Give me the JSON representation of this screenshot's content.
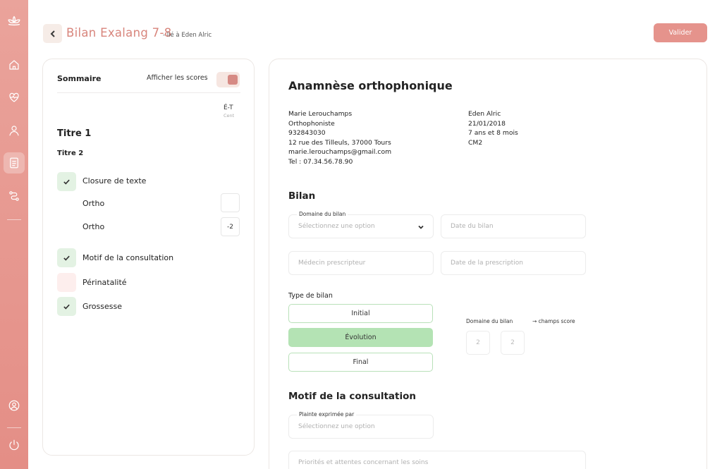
{
  "sidebar": {
    "items": [
      {
        "icon": "lotus-icon"
      },
      {
        "icon": "home-icon"
      },
      {
        "icon": "heart-pulse-icon"
      },
      {
        "icon": "user-icon"
      },
      {
        "icon": "document-icon",
        "active": true
      },
      {
        "icon": "route-icon"
      },
      {
        "icon": "profile-icon"
      },
      {
        "icon": "power-icon"
      }
    ]
  },
  "header": {
    "title": "Bilan Exalang 7-8",
    "subtitle": "- lié à Eden Alric",
    "validate_label": "Valider"
  },
  "summary": {
    "title": "Sommaire",
    "show_scores_label": "Afficher les scores",
    "scores_enabled": true,
    "score_col_title": "É-T",
    "score_col_sub": "Cent",
    "heading1": "Titre 1",
    "heading2": "Titre 2",
    "items": [
      {
        "label": "Closure de texte",
        "checked": true
      },
      {
        "label": "Motif de la consultation",
        "checked": true
      },
      {
        "label": "Périnatalité",
        "checked": false
      },
      {
        "label": "Grossesse",
        "checked": true
      }
    ],
    "sub_items": [
      {
        "label": "Ortho",
        "score": ""
      },
      {
        "label": "Ortho",
        "score": "-2"
      }
    ]
  },
  "form": {
    "title": "Anamnèse orthophonique",
    "therapist": {
      "name": "Marie Lerouchamps",
      "role": "Orthophoniste",
      "id": "932843030",
      "address": "12 rue des Tilleuls, 37000 Tours",
      "email": "marie.lerouchamps@gmail.com",
      "phone": "Tel : 07.34.56.78.90"
    },
    "patient": {
      "name": "Eden Alric",
      "birthdate": "21/01/2018",
      "age": "7 ans et 8 mois",
      "grade": "CM2"
    },
    "bilan": {
      "title": "Bilan",
      "domain_label": "Domaine du bilan",
      "domain_placeholder": "Sélectionnez une option",
      "date_placeholder": "Date du bilan",
      "doctor_placeholder": "Médecin prescripteur",
      "prescription_placeholder": "Date de la prescription",
      "type_label": "Type de bilan",
      "types": [
        "Initial",
        "Évolution",
        "Final"
      ],
      "selected_type": "Évolution",
      "score_domain_label": "Domaine du bilan",
      "score_fields_label": "→ champs score",
      "score_values": [
        "2",
        "2"
      ]
    },
    "consultation": {
      "title": "Motif de la consultation",
      "complaint_label": "Plainte exprimée par",
      "complaint_placeholder": "Sélectionnez une option",
      "priorities_placeholder": "Priorités et attentes concernant les soins"
    }
  },
  "colors": {
    "accent": "#e5938c",
    "title_accent": "#d8857c",
    "check_bg": "#e3f2e3",
    "selected_green": "#b4e3b4"
  }
}
